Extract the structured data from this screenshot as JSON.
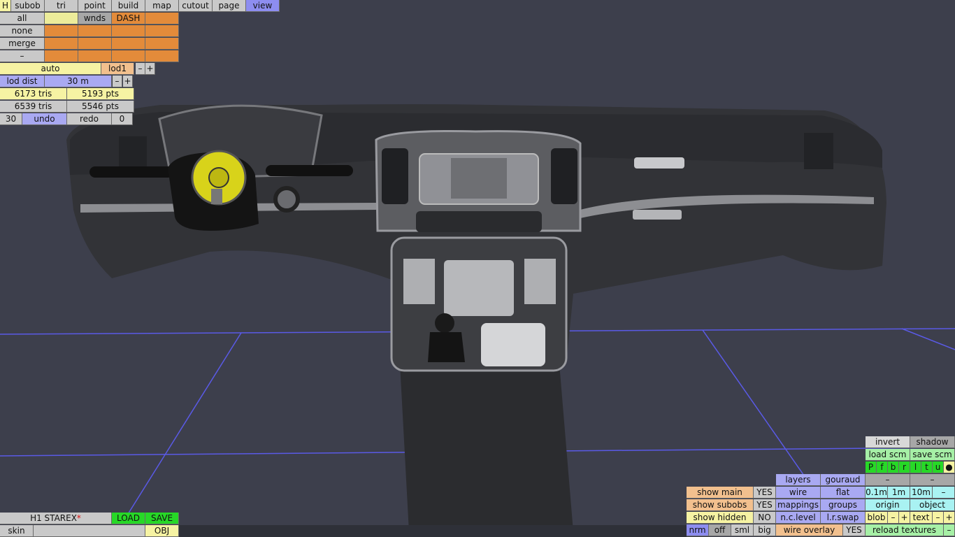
{
  "tabs": [
    "H",
    "subob",
    "tri",
    "point",
    "build",
    "map",
    "cutout",
    "page",
    "view"
  ],
  "select": {
    "all": "all",
    "none": "none",
    "merge": "merge",
    "minus": "–",
    "wnds": "wnds",
    "dash": "DASH"
  },
  "lod": {
    "auto": "auto",
    "level": "lod1",
    "dec": "–",
    "inc": "+",
    "dist_label": "lod dist",
    "dist_value": "30 m"
  },
  "stats": {
    "tris1": "6173 tris",
    "pts1": "5193 pts",
    "tris2": "6539 tris",
    "pts2": "5546 pts"
  },
  "history": {
    "count": "30",
    "undo": "undo",
    "redo": "redo",
    "num": "0"
  },
  "file": {
    "name": "H1 STAREX",
    "modified": "*",
    "load": "LOAD",
    "save": "SAVE",
    "skin": "skin",
    "obj": "OBJ"
  },
  "right": {
    "invert": "invert",
    "shadow": "shadow",
    "load_scm": "load scm",
    "save_scm": "save scm",
    "view_letters": [
      "P",
      "f",
      "b",
      "r",
      "l",
      "t",
      "u",
      "●"
    ],
    "layers": "layers",
    "gouraud": "gouraud",
    "dash": "–",
    "wire": "wire",
    "flat": "flat",
    "step1": "0.1m",
    "step2": "1m",
    "step3": "10m",
    "mappings": "mappings",
    "groups": "groups",
    "origin": "origin",
    "object": "object",
    "nclevel": "n.c.level",
    "lrswap": "l.r.swap",
    "blob": "blob",
    "text": "text",
    "wire_overlay": "wire overlay",
    "yes": "YES",
    "reload": "reload textures",
    "show_main": "show main",
    "show_subobs": "show subobs",
    "show_hidden": "show hidden",
    "no": "NO",
    "nrm": "nrm",
    "off": "off",
    "sml": "sml",
    "big": "big",
    "minus": "–",
    "plus": "+"
  },
  "colors": {
    "background": "#3d3f4c",
    "grid": "#5a5ae6",
    "body": "#2d2e31",
    "accent_yellow": "#d8d31a"
  }
}
